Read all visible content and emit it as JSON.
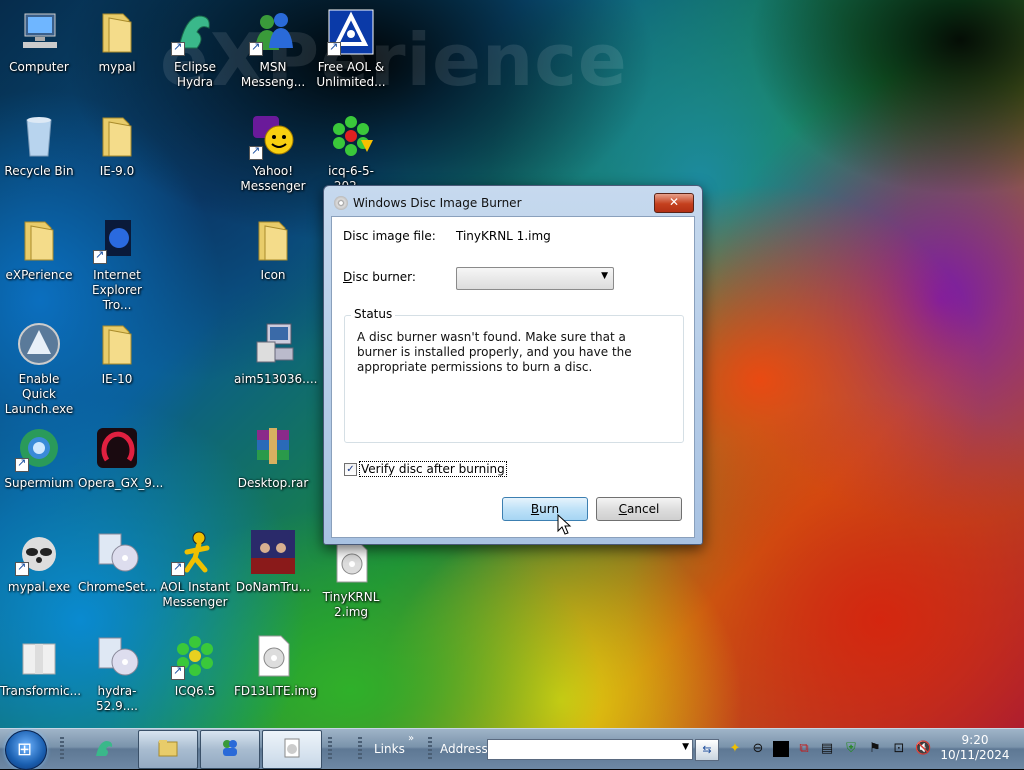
{
  "desktop": {
    "watermark": "eXPerience",
    "icons": [
      {
        "label": "Computer"
      },
      {
        "label": "mypal"
      },
      {
        "label": "Eclipse Hydra"
      },
      {
        "label": "MSN\nMesseng..."
      },
      {
        "label": "Free AOL &\nUnlimited..."
      },
      {
        "label": "Recycle Bin"
      },
      {
        "label": "IE-9.0"
      },
      {
        "label": "Yahoo!\nMessenger"
      },
      {
        "label": "icq-6-5-202..."
      },
      {
        "label": "eXPerience"
      },
      {
        "label": "Internet\nExplorer Tro..."
      },
      {
        "label": "Icon"
      },
      {
        "label": "Enable Quick\nLaunch.exe"
      },
      {
        "label": "IE-10"
      },
      {
        "label": "aim513036...."
      },
      {
        "label": "Supermium"
      },
      {
        "label": "Opera_GX_9..."
      },
      {
        "label": "Desktop.rar"
      },
      {
        "label": "mypal.exe"
      },
      {
        "label": "ChromeSet..."
      },
      {
        "label": "AOL Instant\nMessenger"
      },
      {
        "label": "DoNamTru..."
      },
      {
        "label": "TinyKRNL\n2.img"
      },
      {
        "label": "Transformic..."
      },
      {
        "label": "hydra-52.9...."
      },
      {
        "label": "ICQ6.5"
      },
      {
        "label": "FD13LITE.img"
      }
    ]
  },
  "dialog": {
    "title": "Windows Disc Image Burner",
    "close_label": "✕",
    "image_file_label": "Disc image file:",
    "image_file_value": "TinyKRNL 1.img",
    "burner_label": "Disc burner:",
    "burner_value": "",
    "status_title": "Status",
    "status_message": "A disc burner wasn't found. Make sure that a burner is installed properly, and you have the appropriate permissions to burn a disc.",
    "verify_label": "Verify disc after burning",
    "verify_checked": true,
    "burn_label": "Burn",
    "cancel_label": "Cancel"
  },
  "taskbar": {
    "links_label": "Links",
    "address_label": "Address",
    "address_value": "",
    "clock_time": "9:20",
    "clock_date": "10/11/2024"
  }
}
